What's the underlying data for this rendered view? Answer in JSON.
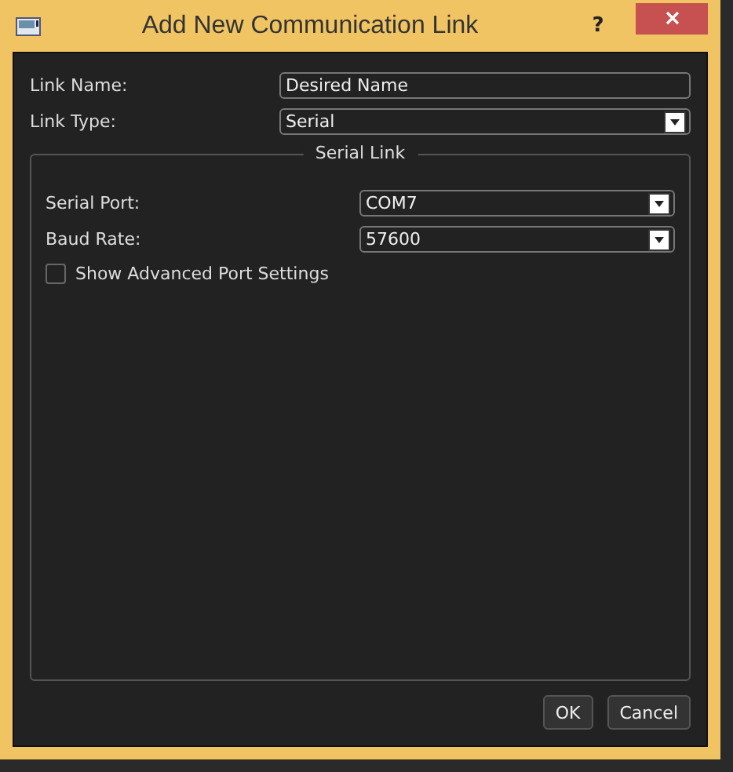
{
  "window": {
    "title": "Add New Communication Link",
    "help": "?"
  },
  "fields": [
    {
      "kind": "text",
      "label": "Link Name:",
      "value": "Desired Name"
    },
    {
      "kind": "combo",
      "label": "Link Type:",
      "value": "Serial"
    }
  ],
  "group": {
    "title": "Serial Link",
    "fields": [
      {
        "kind": "combo",
        "label": "Serial Port:",
        "value": "COM7"
      },
      {
        "kind": "combo",
        "label": "Baud Rate:",
        "value": "57600"
      },
      {
        "kind": "checkbox",
        "label": "Show Advanced Port Settings",
        "checked": false
      }
    ]
  },
  "buttons": [
    "OK",
    "Cancel"
  ]
}
